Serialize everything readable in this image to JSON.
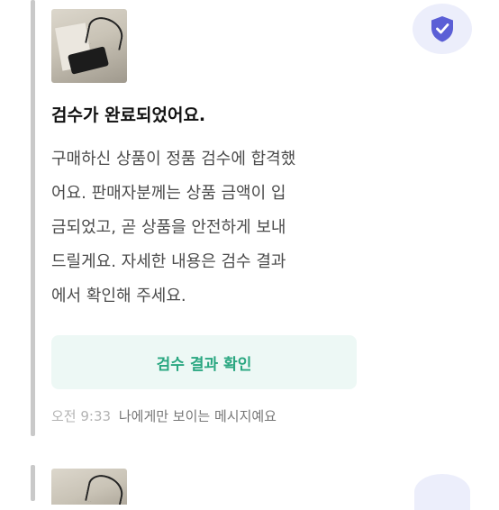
{
  "message": {
    "title": "검수가 완료되었어요.",
    "body": "구매하신 상품이 정품 검수에 합격했\n어요. 판매자분께는 상품 금액이 입\n금되었고, 곧 상품을 안전하게 보내\n드릴게요. 자세한 내용은 검수 결과\n에서 확인해 주세요.",
    "action_label": "검수 결과 확인",
    "time": "오전 9:33",
    "visibility_note": "나에게만 보이는 메시지예요",
    "thumbnail_icon": "product-photo",
    "badge_icon": "verified-shield-icon"
  },
  "colors": {
    "action_text": "#2aa781",
    "action_bg": "#edf8f5",
    "badge_bg": "#eceefb",
    "badge_shield": "#5b5fd6"
  }
}
